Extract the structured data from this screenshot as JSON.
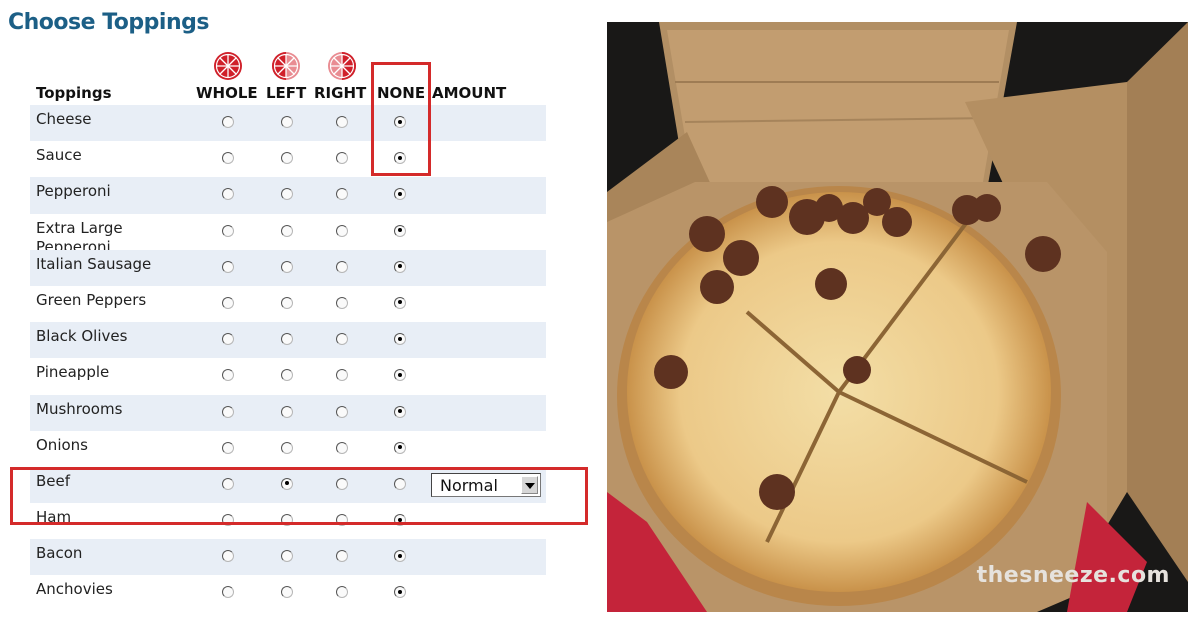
{
  "toppings_panel": {
    "title": "Choose Toppings",
    "columns": {
      "toppings": "Toppings",
      "whole": "WHOLE",
      "left": "LEFT",
      "right": "RIGHT",
      "none": "NONE",
      "amount": "AMOUNT"
    },
    "rows": [
      {
        "label": "Cheese",
        "selected": "none"
      },
      {
        "label": "Sauce",
        "selected": "none"
      },
      {
        "label": "Pepperoni",
        "selected": "none"
      },
      {
        "label": "Extra Large Pepperoni",
        "selected": "none"
      },
      {
        "label": "Italian Sausage",
        "selected": "none"
      },
      {
        "label": "Green Peppers",
        "selected": "none"
      },
      {
        "label": "Black Olives",
        "selected": "none"
      },
      {
        "label": "Pineapple",
        "selected": "none"
      },
      {
        "label": "Mushrooms",
        "selected": "none"
      },
      {
        "label": "Onions",
        "selected": "none"
      },
      {
        "label": "Beef",
        "selected": "left",
        "amount": "Normal"
      },
      {
        "label": "Ham",
        "selected": "none"
      },
      {
        "label": "Bacon",
        "selected": "none"
      },
      {
        "label": "Anchovies",
        "selected": "none"
      }
    ]
  },
  "photo": {
    "watermark": "thesneeze.com"
  },
  "colors": {
    "title": "#1c5f86",
    "row_shade": "#e8eef6",
    "highlight": "#d42a2a",
    "pie_icon": "#d0202a"
  },
  "icons": {
    "whole": "pizza-whole-icon",
    "left": "pizza-left-half-icon",
    "right": "pizza-right-half-icon"
  }
}
